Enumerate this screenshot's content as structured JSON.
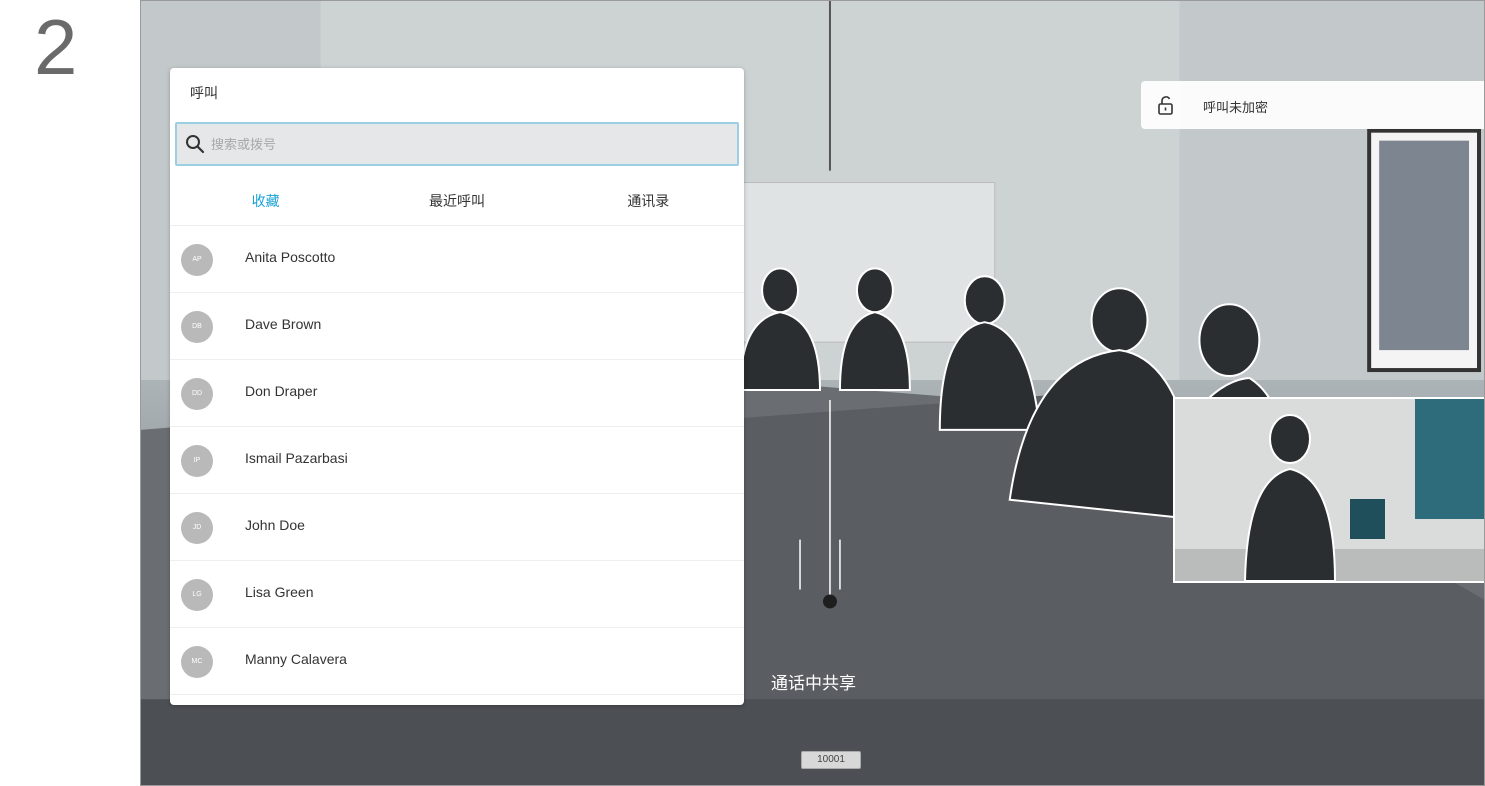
{
  "step_number": "2",
  "call_panel": {
    "title": "呼叫",
    "search": {
      "placeholder": "搜索或拨号",
      "value": ""
    },
    "tabs": [
      {
        "label": "收藏",
        "active": true
      },
      {
        "label": "最近呼叫",
        "active": false
      },
      {
        "label": "通讯录",
        "active": false
      }
    ],
    "contacts": [
      {
        "name": "Anita Poscotto",
        "initials": "AP"
      },
      {
        "name": "Dave Brown",
        "initials": "DB"
      },
      {
        "name": "Don Draper",
        "initials": "DD"
      },
      {
        "name": "Ismail Pazarbasi",
        "initials": "IP"
      },
      {
        "name": "John Doe",
        "initials": "JD"
      },
      {
        "name": "Lisa Green",
        "initials": "LG"
      },
      {
        "name": "Manny Calavera",
        "initials": "MC"
      }
    ]
  },
  "encryption_status": {
    "text": "呼叫未加密",
    "icon": "unlock-icon"
  },
  "share_label": "通话中共享",
  "number_tag": "10001",
  "colors": {
    "accent": "#1aa2d6",
    "panel_bg": "#ffffff",
    "search_bg": "#e6e7e8",
    "avatar_bg": "#b9b9b9"
  }
}
